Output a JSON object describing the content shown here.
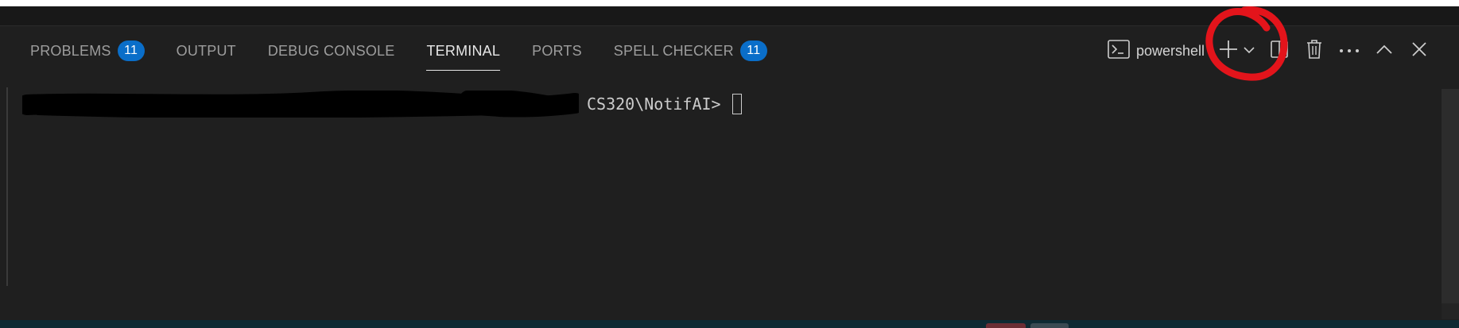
{
  "tabs": [
    {
      "label": "PROBLEMS",
      "badge": "11",
      "active": false
    },
    {
      "label": "OUTPUT",
      "active": false
    },
    {
      "label": "DEBUG CONSOLE",
      "active": false
    },
    {
      "label": "TERMINAL",
      "active": true
    },
    {
      "label": "PORTS",
      "active": false
    },
    {
      "label": "SPELL CHECKER",
      "badge": "11",
      "active": false
    }
  ],
  "toolbar": {
    "terminal_name": "powershell",
    "terminal_icon": "terminal-icon",
    "new_terminal_icon": "plus-icon",
    "dropdown_icon": "chevron-down-icon",
    "split_icon": "split-editor-icon",
    "kill_icon": "trash-icon",
    "more_icon": "ellipsis-icon",
    "maximize_icon": "chevron-up-icon",
    "close_icon": "close-icon"
  },
  "terminal": {
    "prompt_visible": "CS320\\NotifAI>"
  },
  "colors": {
    "background": "#1f1f1f",
    "badge": "#0a6ec9",
    "highlight": "#e3141b",
    "text": "#cccccc"
  }
}
